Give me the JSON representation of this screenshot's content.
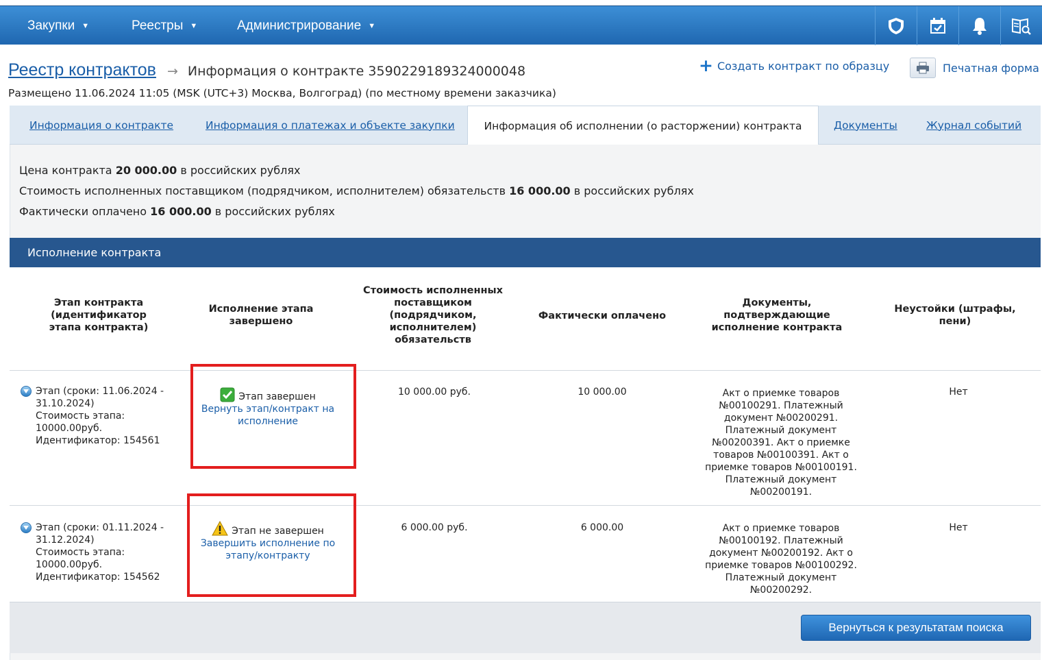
{
  "nav": {
    "menus": [
      {
        "label": "Закупки"
      },
      {
        "label": "Реестры"
      },
      {
        "label": "Администрирование"
      }
    ],
    "icons": [
      "shield-icon",
      "calendar-check-icon",
      "bell-icon",
      "book-search-icon"
    ]
  },
  "header": {
    "breadcrumb_link": "Реестр контрактов",
    "breadcrumb_arrow": "→",
    "current_page": "Информация о контракте 3590229189324000048",
    "posted": "Размещено 11.06.2024 11:05 (MSK (UTC+3) Москва, Волгоград) (по местному времени заказчика)",
    "create_by_sample": "Создать контракт по образцу",
    "print_form": "Печатная форма"
  },
  "tabs": [
    {
      "label": "Информация о контракте"
    },
    {
      "label": "Информация о платежах и объекте закупки"
    },
    {
      "label": "Информация об исполнении (о расторжении) контракта",
      "active": true
    },
    {
      "label": "Документы"
    },
    {
      "label": "Журнал событий"
    }
  ],
  "summary": {
    "price_prefix": "Цена контракта ",
    "price_value": "20 000.00",
    "price_suffix": " в российских рублях",
    "fulfilled_prefix": "Стоимость исполненных поставщиком (подрядчиком, исполнителем) обязательств ",
    "fulfilled_value": "16 000.00",
    "fulfilled_suffix": " в российских рублях",
    "paid_prefix": "Фактически оплачено ",
    "paid_value": "16 000.00",
    "paid_suffix": " в российских рублях"
  },
  "section_title": "Исполнение контракта",
  "table": {
    "headers": [
      "Этап контракта (идентификатор этапа контракта)",
      "Исполнение этапа завершено",
      "Стоимость исполненных поставщиком (подрядчиком, исполнителем) обязательств",
      "Фактически оплачено",
      "Документы, подтверждающие исполнение контракта",
      "Неустойки (штрафы, пени)"
    ],
    "rows": [
      {
        "stage_l1": "Этап (сроки: 11.06.2024 -",
        "stage_l2": "31.10.2024)",
        "stage_l3": "Стоимость этапа:",
        "stage_l4": "10000.00руб.",
        "stage_l5": "Идентификатор: 154561",
        "status": "Этап завершен",
        "action": "Вернуть этап/контракт на исполнение",
        "fulfilled": "10 000.00 руб.",
        "paid": "10 000.00",
        "documents": "Акт о приемке товаров №00100291. Платежный документ №00200291. Платежный документ №00200391. Акт о приемке товаров №00100391. Акт о приемке товаров №00100191. Платежный документ №00200191.",
        "penalties": "Нет"
      },
      {
        "stage_l1": "Этап (сроки: 01.11.2024 -",
        "stage_l2": "31.12.2024)",
        "stage_l3": "Стоимость этапа:",
        "stage_l4": "10000.00руб.",
        "stage_l5": "Идентификатор: 154562",
        "status": "Этап не завершен",
        "action": "Завершить исполнение по этапу/контракту",
        "fulfilled": "6 000.00 руб.",
        "paid": "6 000.00",
        "documents": "Акт о приемке товаров №00100192. Платежный документ №00200192. Акт о приемке товаров №00100292. Платежный документ №00200292.",
        "penalties": "Нет"
      }
    ]
  },
  "footer": {
    "back_button": "Вернуться к результатам поиска"
  },
  "colors": {
    "nav": "#2a78c4",
    "section_header": "#27578f",
    "link": "#1a5ea8",
    "highlight": "#e31e1e"
  }
}
